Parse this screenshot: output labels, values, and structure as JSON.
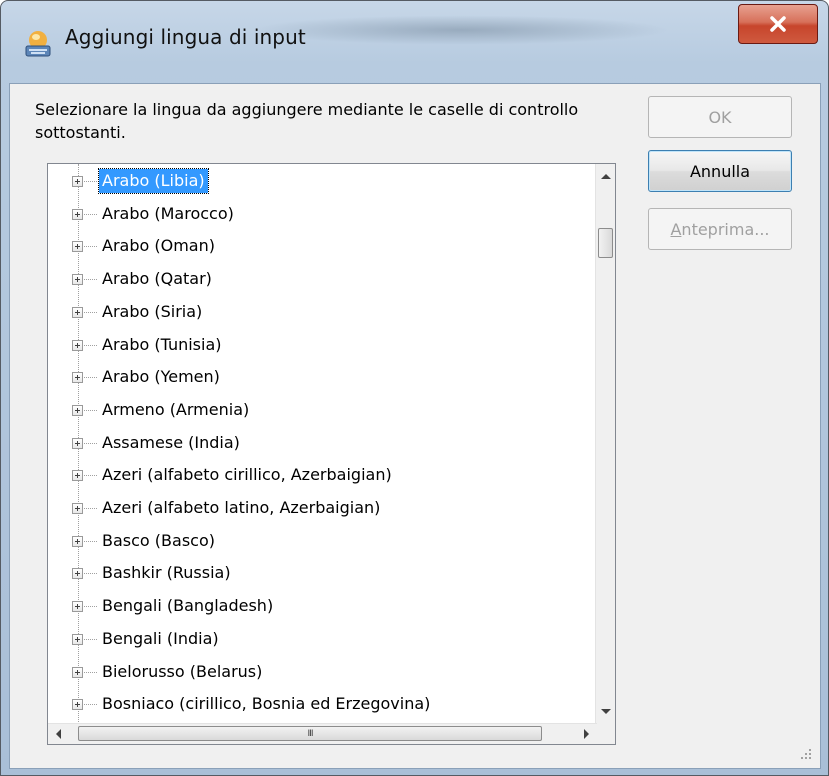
{
  "window": {
    "title": "Aggiungi lingua di input",
    "icon": "keyboard-globe-icon"
  },
  "dialog": {
    "instructions": "Selezionare la lingua da aggiungere mediante le caselle di controllo sottostanti.",
    "buttons": {
      "ok": "OK",
      "cancel": "Annulla",
      "preview_accel": "A",
      "preview_rest": "nteprima..."
    },
    "language_tree": {
      "selected_index": 0,
      "items": [
        "Arabo (Libia)",
        "Arabo (Marocco)",
        "Arabo (Oman)",
        "Arabo (Qatar)",
        "Arabo (Siria)",
        "Arabo (Tunisia)",
        "Arabo (Yemen)",
        "Armeno (Armenia)",
        "Assamese (India)",
        "Azeri (alfabeto cirillico, Azerbaigian)",
        "Azeri (alfabeto latino, Azerbaigian)",
        "Basco (Basco)",
        "Bashkir (Russia)",
        "Bengali (Bangladesh)",
        "Bengali (India)",
        "Bielorusso (Belarus)",
        "Bosniaco (cirillico, Bosnia ed Erzegovina)"
      ]
    },
    "hscroll_thumb_grip": "III"
  },
  "colors": {
    "selection": "#3399ff",
    "close_button": "#c7452c",
    "dialog_background": "#f0f0f0"
  }
}
